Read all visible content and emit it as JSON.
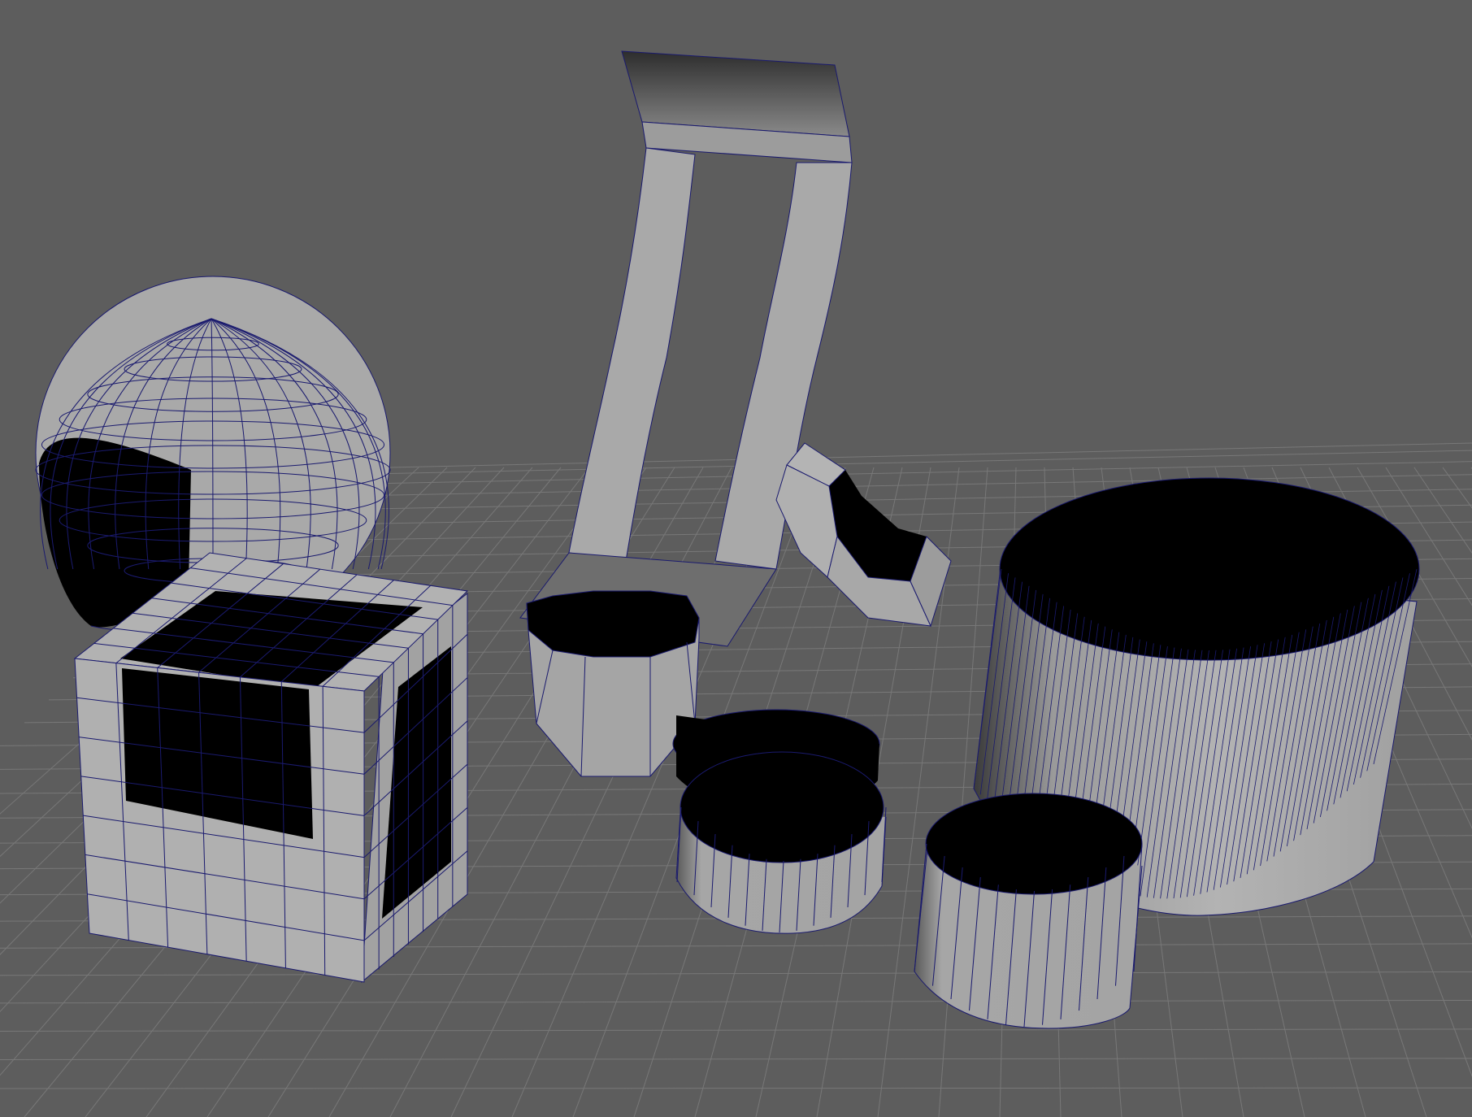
{
  "viewport": {
    "background": "#5d5d5d",
    "grid_color": "#787878",
    "grid_dark": "#555555",
    "surface_color": "#a8a8a8",
    "shadow_color": "#000000",
    "wire_color": "#1a1a6e"
  },
  "objects": [
    {
      "name": "sphere",
      "kind": "open-sphere"
    },
    {
      "name": "cube",
      "kind": "open-cube"
    },
    {
      "name": "plane-strip",
      "kind": "bent-plane"
    },
    {
      "name": "octagon-cylinder",
      "kind": "open-cylinder"
    },
    {
      "name": "small-cylinder-back",
      "kind": "open-cylinder"
    },
    {
      "name": "small-cylinder-front",
      "kind": "open-cylinder"
    },
    {
      "name": "pipe-elbow",
      "kind": "open-pipe"
    },
    {
      "name": "large-cylinder",
      "kind": "open-cylinder"
    },
    {
      "name": "medium-cylinder",
      "kind": "open-cylinder"
    }
  ]
}
